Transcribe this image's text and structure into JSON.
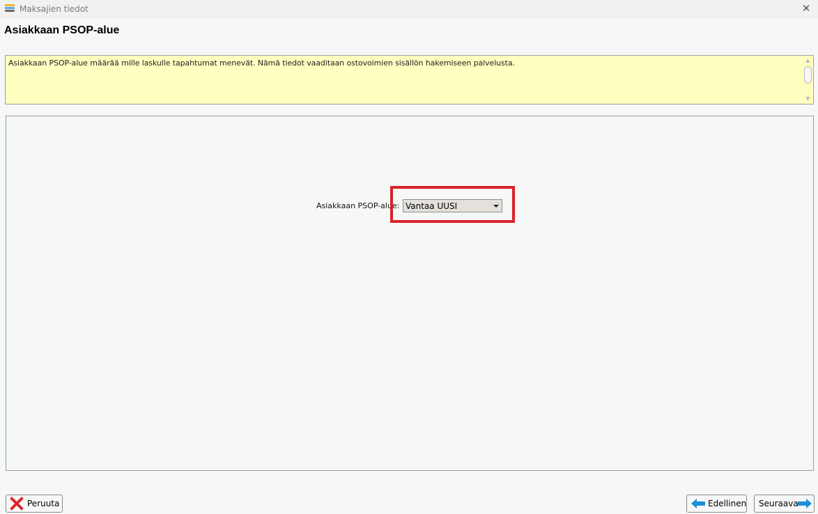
{
  "window": {
    "title": "Maksajien tiedot",
    "icon": "stacked-layers-icon",
    "close_glyph": "✕"
  },
  "page": {
    "title": "Asiakkaan PSOP-alue"
  },
  "info": {
    "text": "Asiakkaan PSOP-alue määrää mille laskulle tapahtumat menevät. Nämä tiedot vaaditaan ostovoimien sisällön hakemiseen palvelusta."
  },
  "form": {
    "psop_label": "Asiakkaan PSOP-alue:",
    "psop_value": "Vantaa UUSI"
  },
  "buttons": {
    "cancel_label": "Peruuta",
    "previous_label": "Edellinen",
    "next_label": "Seuraava"
  },
  "colors": {
    "info_background": "#ffffc0",
    "highlight": "#d8232a",
    "arrow_blue": "#1b8fd6",
    "cancel_red": "#e0252a"
  }
}
